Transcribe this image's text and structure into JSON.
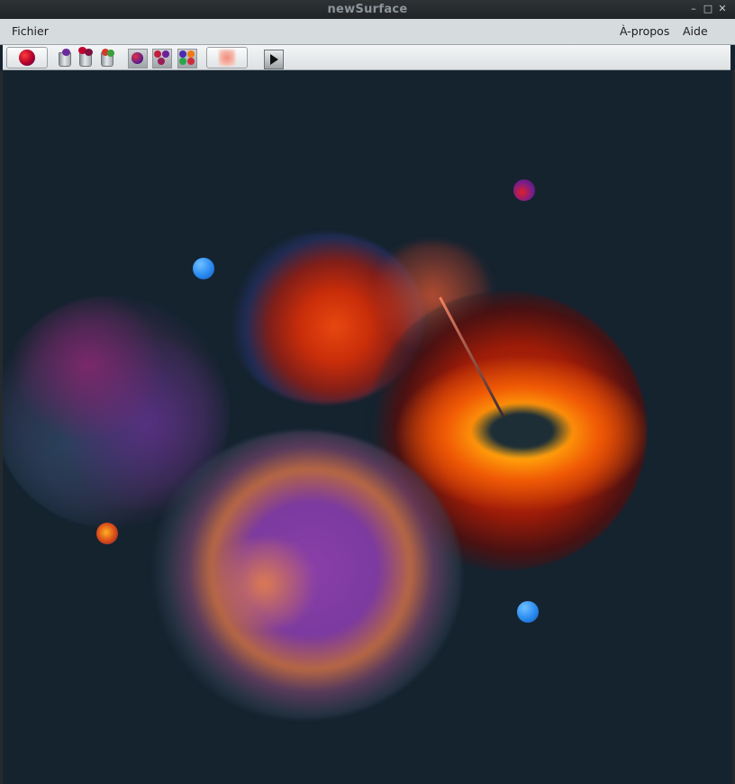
{
  "window": {
    "title": "newSurface"
  },
  "window_controls": {
    "minimize": "–",
    "maximize": "□",
    "close": "✕"
  },
  "menubar": {
    "left": [
      "Fichier"
    ],
    "right": [
      "À-propos",
      "Aide"
    ]
  },
  "toolbar": {
    "buttons": [
      {
        "name": "new-ball-button",
        "icon": "red-sphere-icon"
      },
      {
        "name": "trash-purple-button",
        "icon": "trash-can-purple-icon"
      },
      {
        "name": "trash-red-button",
        "icon": "trash-can-red-icon"
      },
      {
        "name": "trash-multicolor-button",
        "icon": "trash-can-multicolor-icon"
      },
      {
        "name": "single-sphere-mode-button",
        "icon": "single-sphere-icon"
      },
      {
        "name": "multi-sphere-mode-button",
        "icon": "multi-sphere-icon"
      },
      {
        "name": "multicolor-sphere-mode-button",
        "icon": "multicolor-sphere-icon"
      },
      {
        "name": "blur-toggle-button",
        "icon": "blur-square-icon"
      },
      {
        "name": "play-button",
        "icon": "play-icon"
      }
    ]
  },
  "colors": {
    "canvas_bg": "#15232f",
    "titlebar_bg": "#202427",
    "menubar_bg": "#d6dbde",
    "blue_ball": "#2a8af0"
  }
}
